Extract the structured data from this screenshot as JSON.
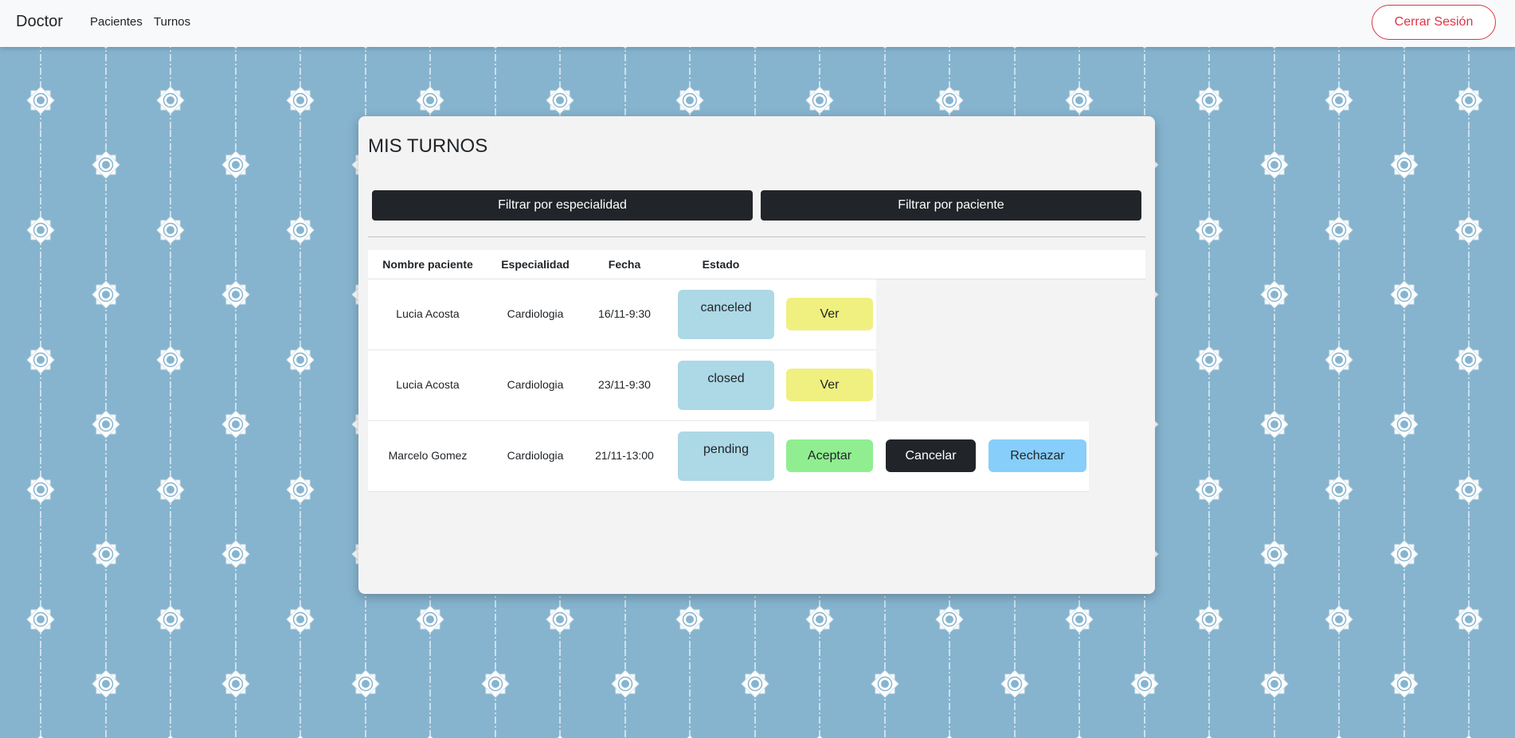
{
  "navbar": {
    "brand": "Doctor",
    "links": [
      "Pacientes",
      "Turnos"
    ],
    "logout_label": "Cerrar Sesión"
  },
  "panel": {
    "title": "MIS TURNOS",
    "filter_especialidad_label": "Filtrar por especialidad",
    "filter_paciente_label": "Filtrar por paciente"
  },
  "table": {
    "columns": [
      "Nombre paciente",
      "Especialidad",
      "Fecha",
      "Estado"
    ],
    "rows": [
      {
        "paciente": "Lucia Acosta",
        "especialidad": "Cardiologia",
        "fecha": "16/11-9:30",
        "estado": "canceled",
        "actions": [
          "Ver"
        ]
      },
      {
        "paciente": "Lucia Acosta",
        "especialidad": "Cardiologia",
        "fecha": "23/11-9:30",
        "estado": "closed",
        "actions": [
          "Ver"
        ]
      },
      {
        "paciente": "Marcelo Gomez",
        "especialidad": "Cardiologia",
        "fecha": "21/11-13:00",
        "estado": "pending",
        "actions": [
          "Aceptar",
          "Cancelar",
          "Rechazar"
        ]
      }
    ]
  },
  "colors": {
    "background": "#86b4cf",
    "navbar": "#f8f9fa",
    "logout_accent": "#dc3545",
    "dark_button": "#212529",
    "estado_badge": "#add8e6",
    "ver_button": "#f0f080",
    "aceptar_button": "#90ee90",
    "rechazar_button": "#87cefa"
  }
}
